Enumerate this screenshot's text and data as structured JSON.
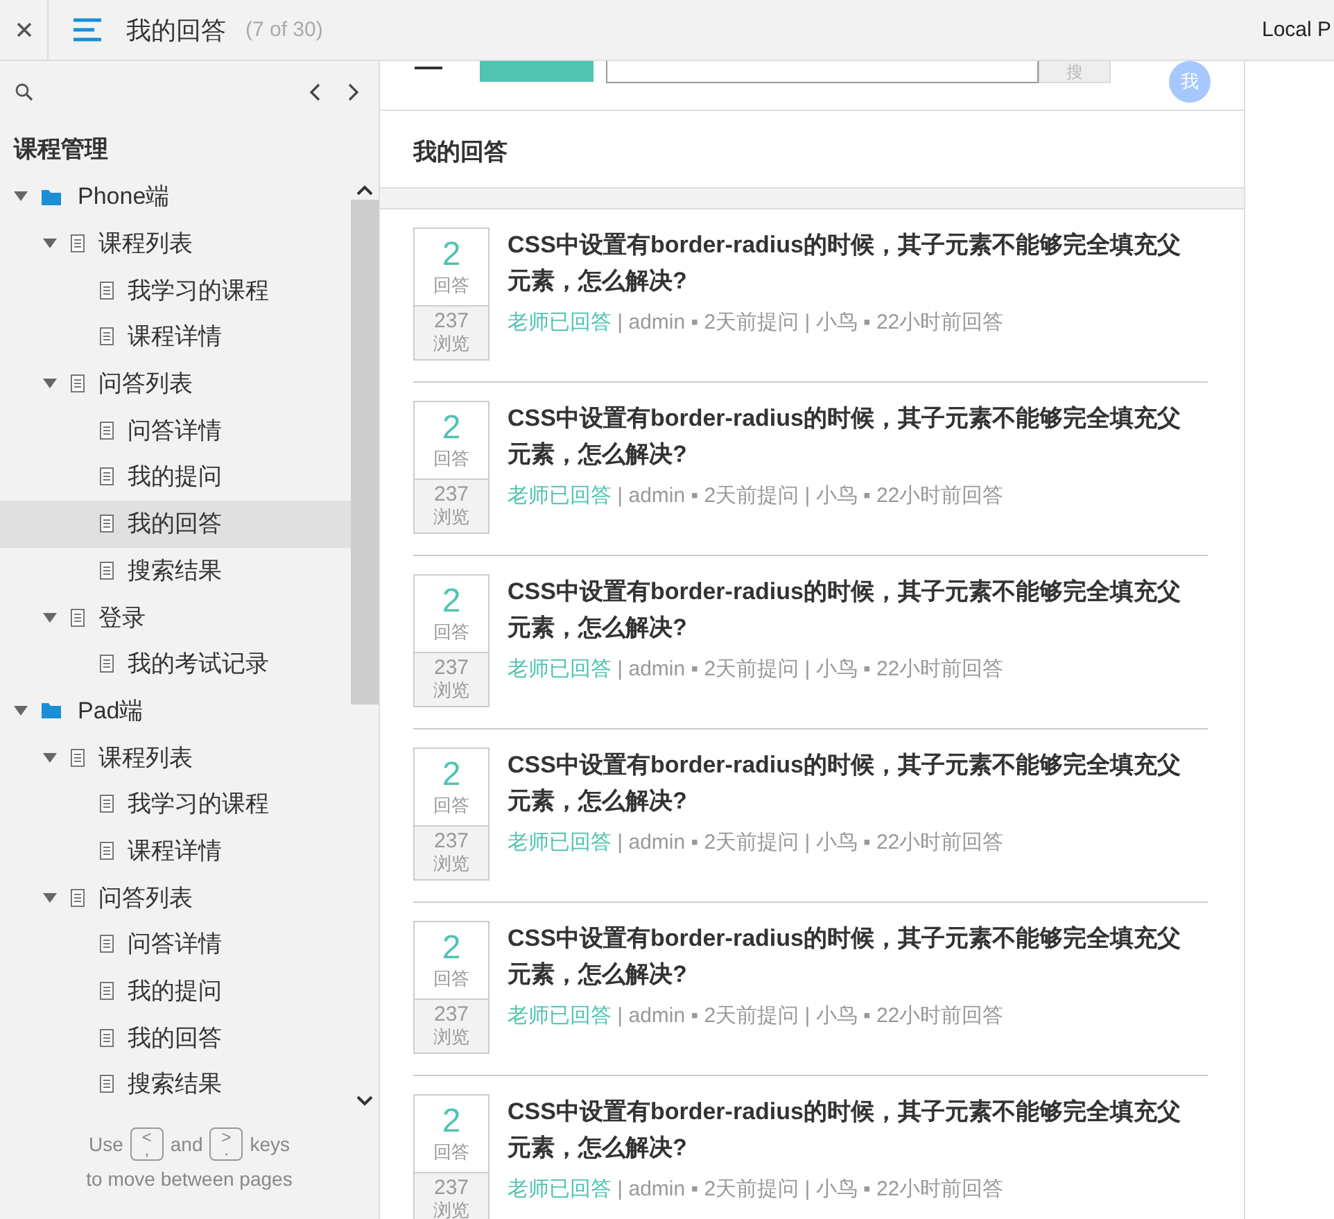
{
  "topbar": {
    "title": "我的回答",
    "page_count": "(7 of 30)",
    "right_label": "Local P"
  },
  "sidebar": {
    "heading": "课程管理",
    "tree": [
      {
        "label": "Phone端",
        "kind": "folder",
        "expanded": true,
        "selected": false,
        "children": [
          {
            "label": "课程列表",
            "kind": "page",
            "expanded": true,
            "selected": false,
            "children": [
              {
                "label": "我学习的课程",
                "kind": "page",
                "selected": false
              },
              {
                "label": "课程详情",
                "kind": "page",
                "selected": false
              }
            ]
          },
          {
            "label": "问答列表",
            "kind": "page",
            "expanded": true,
            "selected": false,
            "children": [
              {
                "label": "问答详情",
                "kind": "page",
                "selected": false
              },
              {
                "label": "我的提问",
                "kind": "page",
                "selected": false
              },
              {
                "label": "我的回答",
                "kind": "page",
                "selected": true
              },
              {
                "label": "搜索结果",
                "kind": "page",
                "selected": false
              }
            ]
          },
          {
            "label": "登录",
            "kind": "page",
            "expanded": true,
            "selected": false,
            "children": [
              {
                "label": "我的考试记录",
                "kind": "page",
                "selected": false
              }
            ]
          }
        ]
      },
      {
        "label": "Pad端",
        "kind": "folder",
        "expanded": true,
        "selected": false,
        "children": [
          {
            "label": "课程列表",
            "kind": "page",
            "expanded": true,
            "selected": false,
            "children": [
              {
                "label": "我学习的课程",
                "kind": "page",
                "selected": false
              },
              {
                "label": "课程详情",
                "kind": "page",
                "selected": false
              }
            ]
          },
          {
            "label": "问答列表",
            "kind": "page",
            "expanded": true,
            "selected": false,
            "children": [
              {
                "label": "问答详情",
                "kind": "page",
                "selected": false
              },
              {
                "label": "我的提问",
                "kind": "page",
                "selected": false
              },
              {
                "label": "我的回答",
                "kind": "page",
                "selected": false
              },
              {
                "label": "搜索结果",
                "kind": "page",
                "selected": false
              }
            ]
          }
        ]
      }
    ],
    "hint": {
      "use": "Use",
      "prev_key": "<",
      "prev_key_sub": ",",
      "and": "and",
      "next_key": ">",
      "next_key_sub": ".",
      "keys": "keys",
      "line2": "to move between pages"
    }
  },
  "page": {
    "search_button": "搜",
    "avatar": "我",
    "heading": "我的回答",
    "questions": [
      {
        "answers": "2",
        "answers_label": "回答",
        "views": "237",
        "views_label": "浏览",
        "title": "CSS中设置有border-radius的时候，其子元素不能够完全填充父元素，怎么解决?",
        "status": "老师已回答",
        "details": "| admin ▪ 2天前提问 | 小鸟 ▪ 22小时前回答"
      },
      {
        "answers": "2",
        "answers_label": "回答",
        "views": "237",
        "views_label": "浏览",
        "title": "CSS中设置有border-radius的时候，其子元素不能够完全填充父元素，怎么解决?",
        "status": "老师已回答",
        "details": "| admin ▪ 2天前提问 | 小鸟 ▪ 22小时前回答"
      },
      {
        "answers": "2",
        "answers_label": "回答",
        "views": "237",
        "views_label": "浏览",
        "title": "CSS中设置有border-radius的时候，其子元素不能够完全填充父元素，怎么解决?",
        "status": "老师已回答",
        "details": "| admin ▪ 2天前提问 | 小鸟 ▪ 22小时前回答"
      },
      {
        "answers": "2",
        "answers_label": "回答",
        "views": "237",
        "views_label": "浏览",
        "title": "CSS中设置有border-radius的时候，其子元素不能够完全填充父元素，怎么解决?",
        "status": "老师已回答",
        "details": "| admin ▪ 2天前提问 | 小鸟 ▪ 22小时前回答"
      },
      {
        "answers": "2",
        "answers_label": "回答",
        "views": "237",
        "views_label": "浏览",
        "title": "CSS中设置有border-radius的时候，其子元素不能够完全填充父元素，怎么解决?",
        "status": "老师已回答",
        "details": "| admin ▪ 2天前提问 | 小鸟 ▪ 22小时前回答"
      },
      {
        "answers": "2",
        "answers_label": "回答",
        "views": "237",
        "views_label": "浏览",
        "title": "CSS中设置有border-radius的时候，其子元素不能够完全填充父元素，怎么解决?",
        "status": "老师已回答",
        "details": "| admin ▪ 2天前提问 | 小鸟 ▪ 22小时前回答"
      }
    ]
  }
}
